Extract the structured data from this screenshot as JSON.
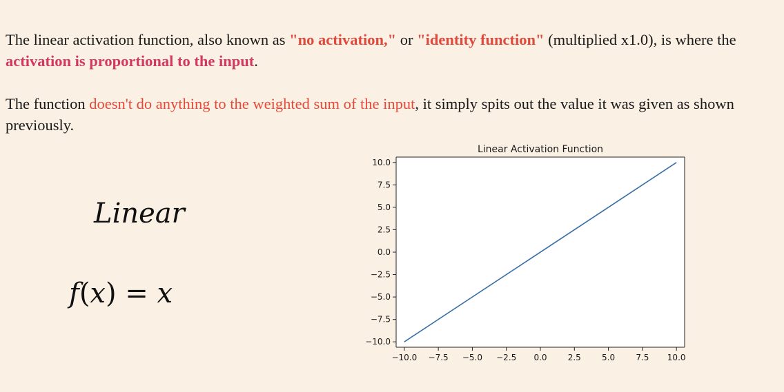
{
  "paragraph1": {
    "t1": "The linear activation function, also known as ",
    "h1": "\"no activation,\"",
    "t2": " or ",
    "h2": "\"identity function\"",
    "t3": " (multiplied x1.0), is where the ",
    "h3": "activation is proportional to the input",
    "t4": "."
  },
  "paragraph2": {
    "t1": "The function ",
    "h1": "doesn't do anything to the weighted sum of the input",
    "t2": ", it simply spits out the value it was given as shown previously."
  },
  "formula": {
    "label": "Linear",
    "f": "f",
    "lp": "(",
    "x": "x",
    "rp": ")",
    "eq": " = ",
    "rhs": "x"
  },
  "colors": {
    "background": "#fbf0e4",
    "highlight_red": "#e54b3a",
    "highlight_pink": "#d2395f",
    "line": "#3a6ea5"
  },
  "chart_data": {
    "type": "line",
    "title": "Linear Activation Function",
    "xlabel": "",
    "ylabel": "",
    "x": [
      -10.0,
      10.0
    ],
    "series": [
      {
        "values": [
          -10.0,
          10.0
        ]
      }
    ],
    "xlim": [
      -10.6,
      10.6
    ],
    "ylim": [
      -10.6,
      10.6
    ],
    "xticks": [
      "−10.0",
      "−7.5",
      "−5.0",
      "−2.5",
      "0.0",
      "2.5",
      "5.0",
      "7.5",
      "10.0"
    ],
    "yticks": [
      "−10.0",
      "−7.5",
      "−5.0",
      "−2.5",
      "0.0",
      "2.5",
      "5.0",
      "7.5",
      "10.0"
    ],
    "grid": false,
    "legend": "none"
  }
}
